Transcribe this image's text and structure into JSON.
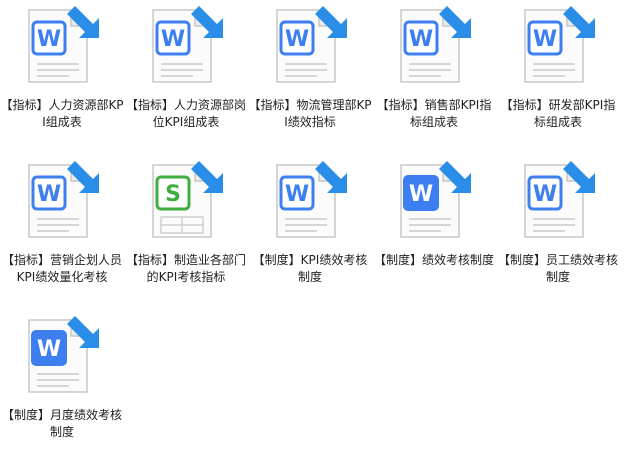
{
  "files": [
    {
      "name": "【指标】人力资源部KPI组成表",
      "type": "word"
    },
    {
      "name": "【指标】人力资源部岗位KPI组成表",
      "type": "word"
    },
    {
      "name": "【指标】物流管理部KPI绩效指标",
      "type": "word"
    },
    {
      "name": "【指标】销售部KPI指标组成表",
      "type": "word"
    },
    {
      "name": "【指标】研发部KPI指标组成表",
      "type": "word"
    },
    {
      "name": "【指标】营销企划人员KPI绩效量化考核",
      "type": "word"
    },
    {
      "name": "【指标】制造业各部门的KPI考核指标",
      "type": "spreadsheet"
    },
    {
      "name": "【制度】KPI绩效考核制度",
      "type": "word"
    },
    {
      "name": "【制度】绩效考核制度",
      "type": "word-solid"
    },
    {
      "name": "【制度】员工绩效考核制度",
      "type": "word"
    },
    {
      "name": "【制度】月度绩效考核制度",
      "type": "word-solid"
    }
  ],
  "colors": {
    "word_blue": "#3d7ff0",
    "spreadsheet_green": "#3fae3f",
    "shortcut_arrow": "#2a8de8"
  }
}
